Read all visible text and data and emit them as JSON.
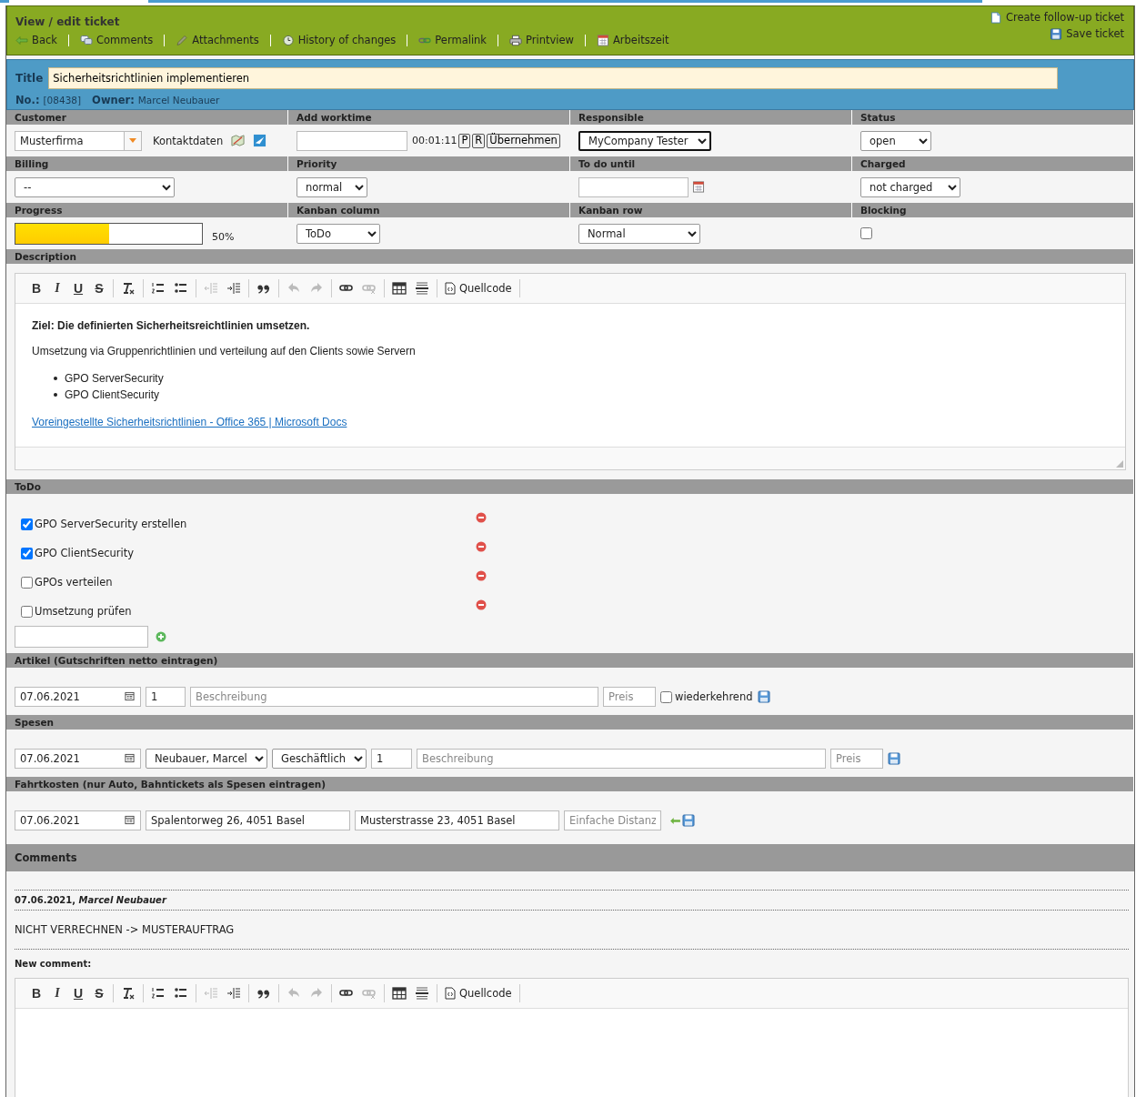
{
  "header": {
    "title": "View / edit ticket",
    "actions": [
      {
        "kind": "back",
        "label": "Back"
      },
      {
        "kind": "comments",
        "label": "Comments"
      },
      {
        "kind": "attachments",
        "label": "Attachments"
      },
      {
        "kind": "history",
        "label": "History of changes"
      },
      {
        "kind": "permalink",
        "label": "Permalink"
      },
      {
        "kind": "print",
        "label": "Printview"
      },
      {
        "kind": "calendar",
        "label": "Arbeitszeit"
      }
    ],
    "right_actions": [
      {
        "kind": "document",
        "label": "Create follow-up ticket"
      },
      {
        "kind": "save",
        "label": "Save ticket"
      }
    ]
  },
  "ticket": {
    "title_label": "Title",
    "title": "Sicherheitsrichtlinien implementieren",
    "number_label": "No.:",
    "number": "[08438]",
    "owner_label": "Owner:",
    "owner": "Marcel Neubauer"
  },
  "fields": [
    {
      "label": "Customer",
      "kind": "customer",
      "value": "Musterfirma",
      "link": "Kontaktdaten"
    },
    {
      "label": "Add worktime",
      "kind": "worktime",
      "time": "00:01:11",
      "buttons": [
        "P",
        "R",
        "Übernehmen"
      ]
    },
    {
      "label": "Responsible",
      "kind": "select",
      "value": "MyCompany Tester",
      "focused": true
    },
    {
      "label": "Status",
      "kind": "select",
      "value": "open",
      "focused": false
    },
    {
      "label": "Billing",
      "kind": "select",
      "value": "--",
      "focused": false
    },
    {
      "label": "Priority",
      "kind": "select",
      "value": "normal",
      "focused": false
    },
    {
      "label": "To do until",
      "kind": "date"
    },
    {
      "label": "Charged",
      "kind": "select",
      "value": "not charged",
      "focused": false
    },
    {
      "label": "Progress",
      "kind": "progress",
      "level": 0.5,
      "reading": "50%"
    },
    {
      "label": "Kanban column",
      "kind": "select",
      "value": "ToDo",
      "focused": false
    },
    {
      "label": "Kanban row",
      "kind": "select",
      "value": "Normal",
      "focused": false
    },
    {
      "label": "Blocking",
      "kind": "checkbox",
      "checked": false
    }
  ],
  "description": {
    "label": "Description",
    "toolbar": [
      [
        {
          "kind": "bold",
          "glyph": "B",
          "disabled": false
        },
        {
          "kind": "italic",
          "glyph": "I",
          "disabled": false
        },
        {
          "kind": "underline",
          "glyph": "U",
          "disabled": false
        },
        {
          "kind": "strikethrough",
          "glyph": "S",
          "disabled": false
        }
      ],
      [
        {
          "kind": "clear-format",
          "disabled": false
        }
      ],
      [
        {
          "kind": "numbered-list",
          "disabled": false
        },
        {
          "kind": "bullet-list",
          "disabled": false
        }
      ],
      [
        {
          "kind": "outdent",
          "disabled": true
        },
        {
          "kind": "indent",
          "disabled": false
        }
      ],
      [
        {
          "kind": "blockquote",
          "disabled": false
        }
      ],
      [
        {
          "kind": "undo",
          "disabled": true
        },
        {
          "kind": "redo",
          "disabled": true
        }
      ],
      [
        {
          "kind": "link",
          "disabled": false
        },
        {
          "kind": "unlink",
          "disabled": true
        }
      ],
      [
        {
          "kind": "table",
          "disabled": false
        },
        {
          "kind": "horizontal-line",
          "disabled": false
        }
      ],
      [
        {
          "kind": "source",
          "label": "Quellcode",
          "disabled": false
        }
      ]
    ],
    "heading": "Ziel: Die definierten Sicherheitsreichtlinien umsetzen.",
    "paragraph": "Umsetzung via Gruppenrichtlinien und verteilung auf den Clients sowie Servern",
    "bullets": [
      "GPO ServerSecurity",
      "GPO ClientSecurity"
    ],
    "link": "Voreingestellte Sicherheitsrichtlinien - Office 365 | Microsoft Docs"
  },
  "todo": {
    "label": "ToDo",
    "items": [
      {
        "label": "GPO ServerSecurity erstellen",
        "checked": true
      },
      {
        "label": "GPO ClientSecurity",
        "checked": true
      },
      {
        "label": "GPOs verteilen",
        "checked": false
      },
      {
        "label": "Umsetzung prüfen",
        "checked": false
      }
    ]
  },
  "articles": {
    "label": "Artikel (Gutschriften netto eintragen)",
    "date": "07.06.2021",
    "quantity": "1",
    "description_placeholder": "Beschreibung",
    "price_placeholder": "Preis",
    "recurring_label": "wiederkehrend",
    "recurring": false
  },
  "expenses": {
    "label": "Spesen",
    "date": "07.06.2021",
    "person": "Neubauer, Marcel",
    "type": "Geschäftlich",
    "quantity": "1",
    "description_placeholder": "Beschreibung",
    "price_placeholder": "Preis"
  },
  "travel": {
    "label": "Fahrtkosten (nur Auto, Bahntickets als Spesen eintragen)",
    "date": "07.06.2021",
    "from": "Spalentorweg 26, 4051 Basel",
    "to": "Musterstrasse 23, 4051 Basel",
    "distance_placeholder": "Einfache Distanz"
  },
  "comments": {
    "label": "Comments",
    "items": [
      {
        "header": "07.06.2021, *Marcel Neubauer*",
        "text": "NICHT VERRECHNEN -> MUSTERAUFTRAG"
      }
    ],
    "new_label": "New comment:",
    "toolbar": [
      [
        {
          "kind": "bold",
          "glyph": "B",
          "disabled": false
        },
        {
          "kind": "italic",
          "glyph": "I",
          "disabled": false
        },
        {
          "kind": "underline",
          "glyph": "U",
          "disabled": false
        },
        {
          "kind": "strikethrough",
          "glyph": "S",
          "disabled": false
        }
      ],
      [
        {
          "kind": "clear-format",
          "disabled": false
        }
      ],
      [
        {
          "kind": "numbered-list",
          "disabled": false
        },
        {
          "kind": "bullet-list",
          "disabled": false
        }
      ],
      [
        {
          "kind": "outdent",
          "disabled": true
        },
        {
          "kind": "indent",
          "disabled": false
        }
      ],
      [
        {
          "kind": "blockquote",
          "disabled": false
        }
      ],
      [
        {
          "kind": "undo",
          "disabled": true
        },
        {
          "kind": "redo",
          "disabled": true
        }
      ],
      [
        {
          "kind": "link",
          "disabled": false
        },
        {
          "kind": "unlink",
          "disabled": true
        }
      ],
      [
        {
          "kind": "table",
          "disabled": false
        },
        {
          "kind": "horizontal-line",
          "disabled": false
        }
      ],
      [
        {
          "kind": "source",
          "label": "Quellcode",
          "disabled": false
        }
      ]
    ]
  }
}
